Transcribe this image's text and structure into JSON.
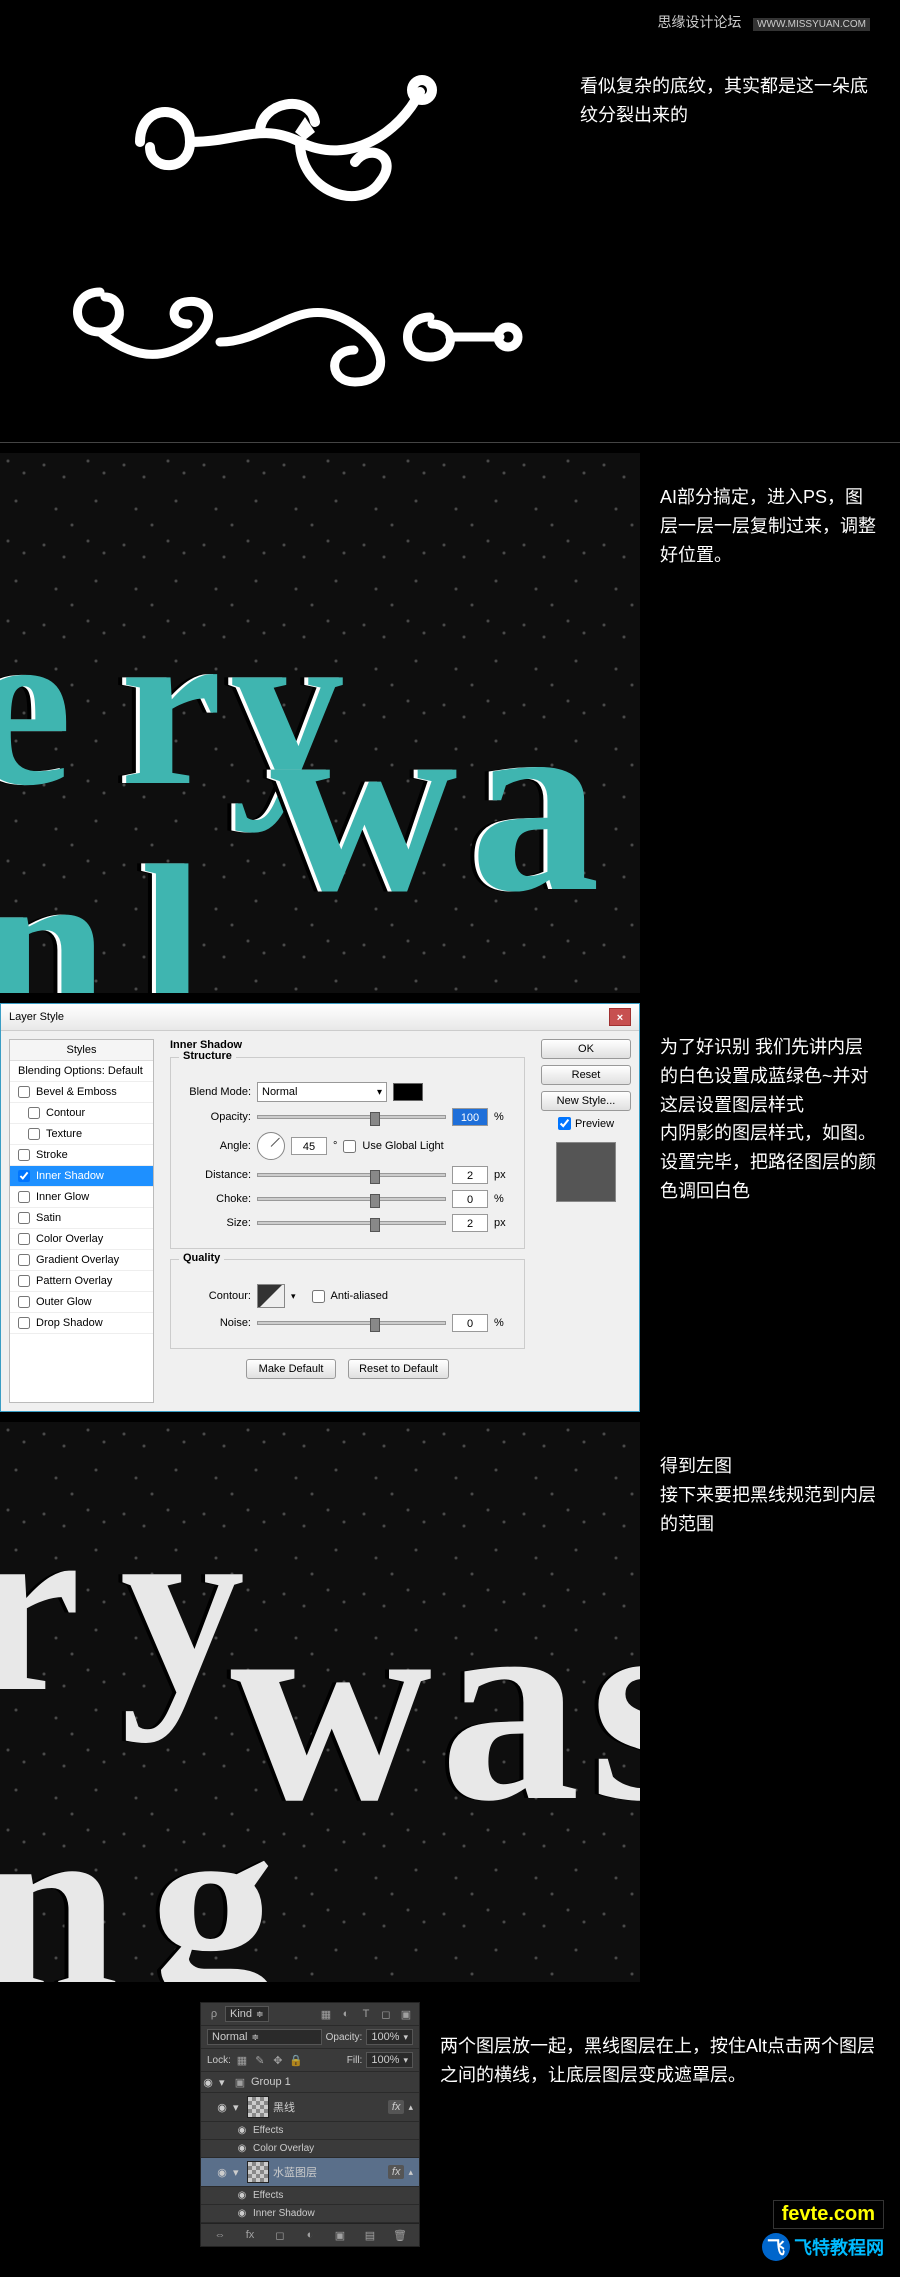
{
  "header_text": "思缘设计论坛",
  "header_url": "WWW.MISSYUAN.COM",
  "section1_text": "看似复杂的底纹，其实都是这一朵底纹分裂出来的",
  "section2_text": "AI部分搞定，进入PS，图层一层一层复制过来，调整好位置。",
  "section3_text": "为了好识别 我们先讲内层的白色设置成蓝绿色~并对这层设置图层样式\n内阴影的图层样式，如图。\n设置完毕，把路径图层的颜色调回白色",
  "section4_text": "得到左图\n接下来要把黑线规范到内层的范围",
  "section5_text": "两个图层放一起，黑线图层在上，按住Alt点击两个图层之间的横线，让底层图层变成遮罩层。",
  "dialog": {
    "title": "Layer Style",
    "styles_header": "Styles",
    "items": [
      {
        "label": "Blending Options: Default",
        "indent": false,
        "checked": null
      },
      {
        "label": "Bevel & Emboss",
        "indent": false,
        "checked": false
      },
      {
        "label": "Contour",
        "indent": true,
        "checked": false
      },
      {
        "label": "Texture",
        "indent": true,
        "checked": false
      },
      {
        "label": "Stroke",
        "indent": false,
        "checked": false
      },
      {
        "label": "Inner Shadow",
        "indent": false,
        "checked": true,
        "selected": true
      },
      {
        "label": "Inner Glow",
        "indent": false,
        "checked": false
      },
      {
        "label": "Satin",
        "indent": false,
        "checked": false
      },
      {
        "label": "Color Overlay",
        "indent": false,
        "checked": false
      },
      {
        "label": "Gradient Overlay",
        "indent": false,
        "checked": false
      },
      {
        "label": "Pattern Overlay",
        "indent": false,
        "checked": false
      },
      {
        "label": "Outer Glow",
        "indent": false,
        "checked": false
      },
      {
        "label": "Drop Shadow",
        "indent": false,
        "checked": false
      }
    ],
    "panel_title": "Inner Shadow",
    "structure_title": "Structure",
    "blend_mode_label": "Blend Mode:",
    "blend_mode_value": "Normal",
    "opacity_label": "Opacity:",
    "opacity_value": "100",
    "percent": "%",
    "angle_label": "Angle:",
    "angle_value": "45",
    "deg": "°",
    "use_global_label": "Use Global Light",
    "distance_label": "Distance:",
    "distance_value": "2",
    "px": "px",
    "choke_label": "Choke:",
    "choke_value": "0",
    "size_label": "Size:",
    "size_value": "2",
    "quality_title": "Quality",
    "contour_label": "Contour:",
    "antialiased_label": "Anti-aliased",
    "noise_label": "Noise:",
    "noise_value": "0",
    "make_default": "Make Default",
    "reset_default": "Reset to Default",
    "ok": "OK",
    "reset": "Reset",
    "new_style": "New Style...",
    "preview": "Preview"
  },
  "layers": {
    "kind_label": "Kind",
    "mode": "Normal",
    "opacity_label": "Opacity:",
    "opacity_value": "100%",
    "lock_label": "Lock:",
    "fill_label": "Fill:",
    "fill_value": "100%",
    "group1": "Group 1",
    "layer_black": "黑线",
    "effects": "Effects",
    "color_overlay": "Color Overlay",
    "layer_teal": "水蓝图层",
    "inner_shadow": "Inner Shadow",
    "fx": "fx"
  },
  "footer": {
    "fevte": "fevte.com",
    "feite": "飞特教程网"
  }
}
